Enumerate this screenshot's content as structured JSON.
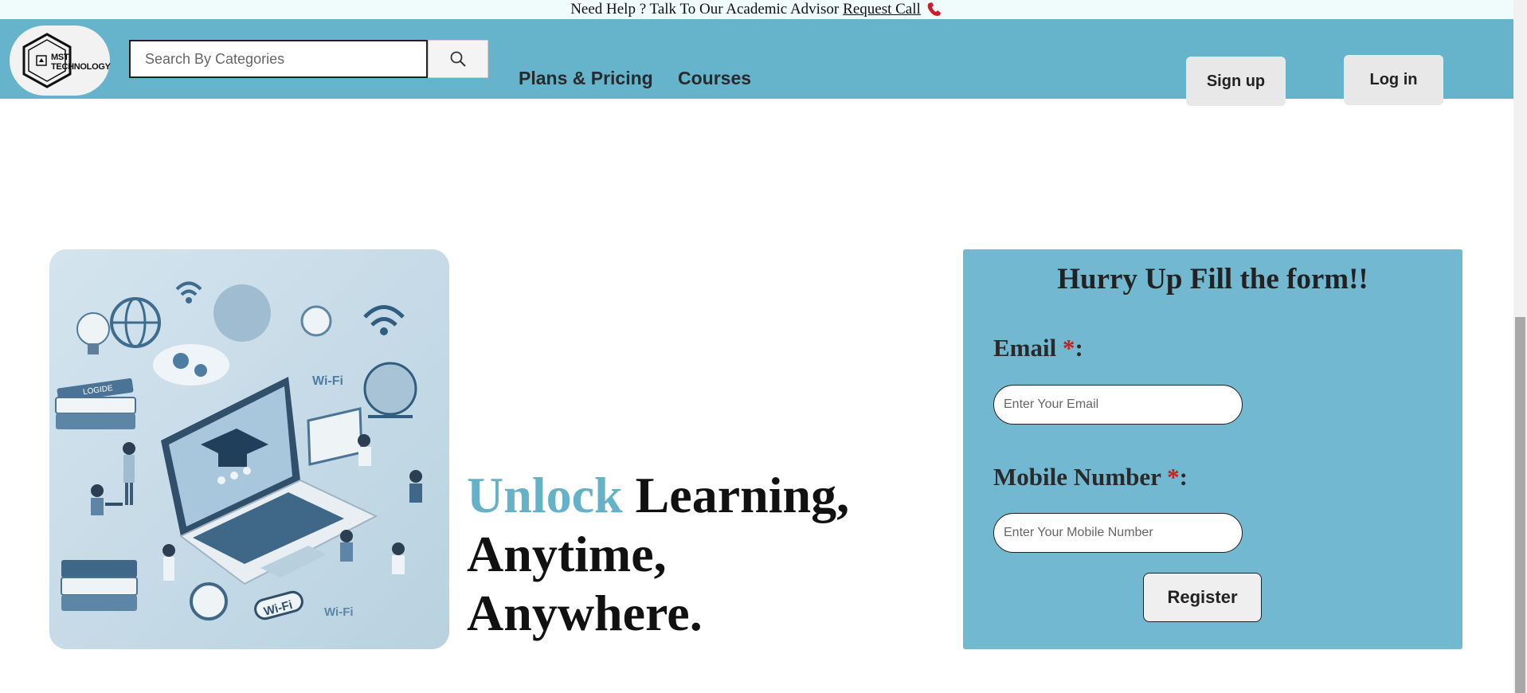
{
  "helpbar": {
    "text": "Need Help ? Talk To Our Academic Advisor",
    "link_label": "Request Call",
    "phone_icon": "phone-icon",
    "phone_color": "#d11a2a"
  },
  "header": {
    "logo_text_line1": "MST",
    "logo_text_line2": "TECHNOLOGY",
    "search_placeholder": "Search By Categories",
    "search_icon": "search-icon",
    "nav": {
      "plans_label": "Plans & Pricing",
      "courses_label": "Courses"
    },
    "signup_label": "Sign up",
    "login_label": "Log in",
    "bg_color": "#66b3cc"
  },
  "hero": {
    "headline_accent": "Unlock",
    "headline_line1_rest": " Learning,",
    "headline_line2": "Anytime,",
    "headline_line3": "Anywhere.",
    "accent_color": "#64b1c8",
    "illustration": {
      "book_label": "LOGIDE",
      "wifi_label_1": "Wi-Fi",
      "wifi_label_2": "Wi-Fi",
      "wifi_label_3": "Wi-Fi"
    }
  },
  "form": {
    "title": "Hurry Up Fill the form!!",
    "email_label": "Email ",
    "mobile_label": "Mobile Number ",
    "required_mark": "*",
    "colon": ":",
    "email_placeholder": "Enter Your Email",
    "mobile_placeholder": "Enter Your Mobile Number",
    "register_label": "Register",
    "bg_color": "#72b8d0"
  }
}
